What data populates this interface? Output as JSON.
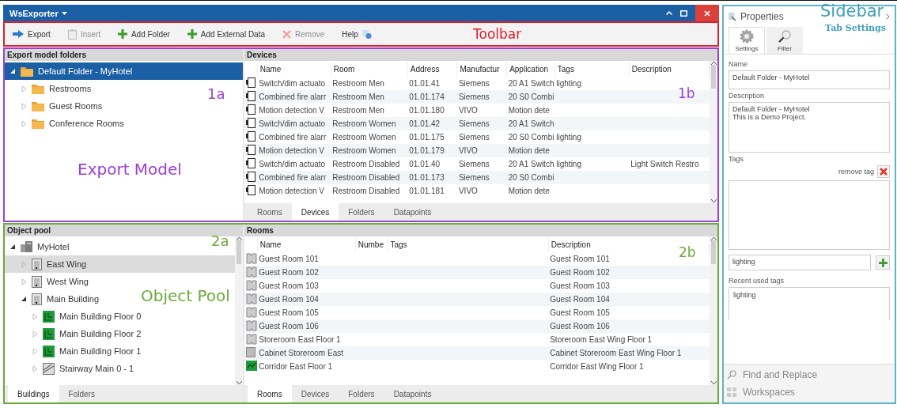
{
  "window": {
    "title": "WsExporter"
  },
  "toolbar": {
    "items": [
      {
        "label": "Export",
        "kind": "export",
        "disabled": false
      },
      {
        "label": "Insert",
        "kind": "insert",
        "disabled": true
      },
      {
        "label": "Add Folder",
        "kind": "add",
        "disabled": false
      },
      {
        "label": "Add External Data",
        "kind": "add",
        "disabled": false
      },
      {
        "label": "Remove",
        "kind": "remove",
        "disabled": true
      },
      {
        "label": "Help",
        "kind": "help",
        "disabled": false
      }
    ]
  },
  "export_model": {
    "title": "Export model folders",
    "focused": true,
    "tree": [
      {
        "label": "Default Folder - MyHotel",
        "kind": "folder",
        "selected": true,
        "expanded": true,
        "children": [
          {
            "label": "Restrooms",
            "kind": "folder",
            "selected": false,
            "expanded": false
          },
          {
            "label": "Guest Rooms",
            "kind": "folder",
            "selected": false,
            "expanded": false
          },
          {
            "label": "Conference Rooms",
            "kind": "folder",
            "selected": false,
            "expanded": false
          }
        ]
      }
    ]
  },
  "devices": {
    "title": "Devices",
    "columns": [
      "Name",
      "Room",
      "Address",
      "Manufactur",
      "Application",
      "Tags",
      "Description"
    ],
    "rows": [
      [
        "Switch/dim actuato",
        "Restroom Men",
        "01.01.41",
        "Siemens",
        "20 A1 Switch",
        "lighting",
        ""
      ],
      [
        "Combined fire alarr",
        "Restroom Men",
        "01.01.174",
        "Siemens",
        "20 S0 Combi",
        "",
        ""
      ],
      [
        "Motion detection V",
        "Restroom Men",
        "01.01.180",
        "VIVO",
        "Motion dete",
        "",
        ""
      ],
      [
        "Switch/dim actuato",
        "Restroom Women",
        "01.01.42",
        "Siemens",
        "20 A1 Switch",
        "",
        ""
      ],
      [
        "Combined fire alarr",
        "Restroom Women",
        "01.01.175",
        "Siemens",
        "20 S0 Combi",
        "lighting",
        ""
      ],
      [
        "Motion detection V",
        "Restroom Women",
        "01.01.179",
        "VIVO",
        "Motion dete",
        "",
        ""
      ],
      [
        "Switch/dim actuato",
        "Restroom Disabled",
        "01.01.40",
        "Siemens",
        "20 A1 Switch",
        "lighting",
        "Light Switch Restro"
      ],
      [
        "Combined fire alarr",
        "Restroom Disabled",
        "01.01.173",
        "Siemens",
        "20 S0 Combi",
        "",
        ""
      ],
      [
        "Motion detection V",
        "Restroom Disabled",
        "01.01.181",
        "VIVO",
        "Motion dete",
        "",
        ""
      ]
    ],
    "tabs": [
      {
        "label": "Rooms",
        "selected": false
      },
      {
        "label": "Devices",
        "selected": true
      },
      {
        "label": "Folders",
        "selected": false
      },
      {
        "label": "Datapoints",
        "selected": false
      }
    ]
  },
  "object_pool": {
    "title": "Object pool",
    "focused": false,
    "tree": [
      {
        "label": "MyHotel",
        "kind": "building",
        "selected": false,
        "expanded": true,
        "children": [
          {
            "label": "East Wing",
            "kind": "wing",
            "selected": true,
            "expanded": false
          },
          {
            "label": "West Wing",
            "kind": "wing",
            "selected": false,
            "expanded": false
          },
          {
            "label": "Main Building",
            "kind": "wing",
            "selected": false,
            "expanded": true,
            "children": [
              {
                "label": "Main Building Floor 0",
                "kind": "floor",
                "selected": false,
                "expanded": false
              },
              {
                "label": "Main Building Floor 2",
                "kind": "floor",
                "selected": false,
                "expanded": false
              },
              {
                "label": "Main Building Floor 1",
                "kind": "floor",
                "selected": false,
                "expanded": false
              },
              {
                "label": "Stairway Main 0 - 1",
                "kind": "stairway",
                "selected": false,
                "expanded": false
              }
            ]
          }
        ]
      }
    ],
    "tabs": [
      {
        "label": "Buildings",
        "selected": true
      },
      {
        "label": "Folders",
        "selected": false
      }
    ]
  },
  "rooms": {
    "title": "Rooms",
    "columns": [
      "Name",
      "Numbe",
      "Tags",
      "Description"
    ],
    "rows": [
      {
        "kind": "room",
        "cells": [
          "Guest Room 101",
          "",
          "",
          "Guest Room 101"
        ]
      },
      {
        "kind": "room",
        "cells": [
          "Guest Room 102",
          "",
          "",
          "Guest Room 102"
        ]
      },
      {
        "kind": "room",
        "cells": [
          "Guest Room 103",
          "",
          "",
          "Guest Room 103"
        ]
      },
      {
        "kind": "room",
        "cells": [
          "Guest Room 104",
          "",
          "",
          "Guest Room 104"
        ]
      },
      {
        "kind": "room",
        "cells": [
          "Guest Room 105",
          "",
          "",
          "Guest Room 105"
        ]
      },
      {
        "kind": "room",
        "cells": [
          "Guest Room 106",
          "",
          "",
          "Guest Room 106"
        ]
      },
      {
        "kind": "room",
        "cells": [
          "Storeroom East Floor 1",
          "",
          "",
          "Storeroom East Wing Floor 1"
        ]
      },
      {
        "kind": "cabinet",
        "cells": [
          "Cabinet Storeroom East",
          "",
          "",
          "Cabinet Storeroom East Wing Floor 1"
        ]
      },
      {
        "kind": "corridor",
        "cells": [
          "Corridor East Floor 1",
          "",
          "",
          "Corridor East Wing Floor 1"
        ]
      }
    ],
    "tabs": [
      {
        "label": "Rooms",
        "selected": true
      },
      {
        "label": "Devices",
        "selected": false
      },
      {
        "label": "Folders",
        "selected": false
      },
      {
        "label": "Datapoints",
        "selected": false
      }
    ]
  },
  "properties": {
    "title": "Properties",
    "tabs": [
      {
        "label": "Settings",
        "kind": "gear",
        "selected": true
      },
      {
        "label": "Filter",
        "kind": "search",
        "selected": false
      }
    ],
    "name_label": "Name",
    "name_value": "Default Folder - MyHotel",
    "description_label": "Description",
    "description_value": "Default Folder - MyHotel\nThis is a Demo Project.",
    "tags_label": "Tags",
    "remove_tag": "remove tag",
    "tag_input": "lighting",
    "recent_label": "Recent used tags",
    "recent_tags": [
      "lighting"
    ],
    "sections": [
      {
        "label": "Find and Replace",
        "kind": "search"
      },
      {
        "label": "Workspaces",
        "kind": "grid"
      }
    ]
  },
  "annotations": [
    {
      "text": "Toolbar",
      "color": "#e0202a"
    },
    {
      "text": "1a",
      "color": "#9b3fd6"
    },
    {
      "text": "Export Model",
      "color": "#9b3fd6"
    },
    {
      "text": "1b",
      "color": "#9b3fd6"
    },
    {
      "text": "2a",
      "color": "#6aaa3a"
    },
    {
      "text": "Object Pool",
      "color": "#6aaa3a"
    },
    {
      "text": "2b",
      "color": "#6aaa3a"
    },
    {
      "text": "Sidebar",
      "color": "#3f9fbf"
    },
    {
      "text": "Tab Settings",
      "color": "#3f9fbf"
    }
  ]
}
